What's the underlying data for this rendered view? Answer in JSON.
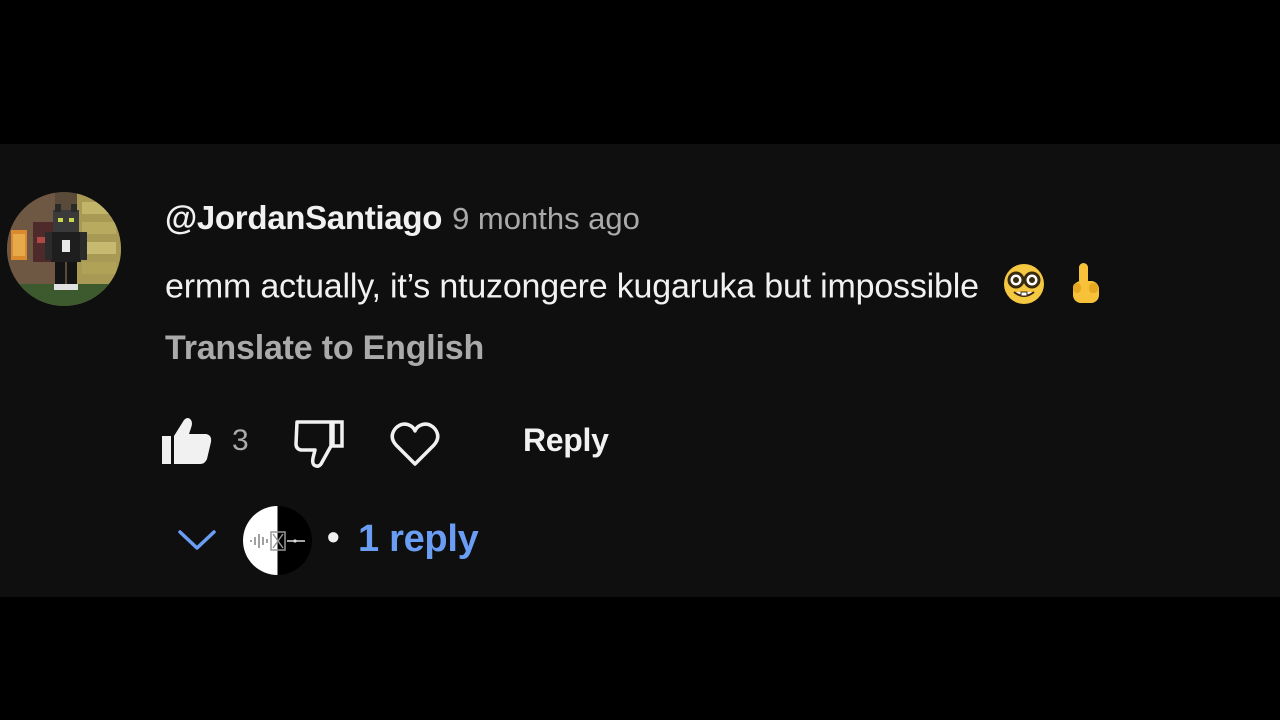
{
  "comment": {
    "author": "@JordanSantiago",
    "timestamp": "9 months ago",
    "text": "ermm actually, it’s ntuzongere kugaruka but impossible",
    "emojis": [
      "nerd-face-emoji",
      "index-pointing-up-emoji"
    ],
    "translate_label": "Translate to English",
    "like_count": "3",
    "reply_label": "Reply",
    "replies": {
      "separator": "•",
      "label": "1 reply"
    }
  },
  "colors": {
    "page_background": "#000000",
    "card_background": "#0f0f0f",
    "primary_text": "#f1f1f1",
    "secondary_text": "#aaaaaa",
    "replies_link": "#6a9ef5"
  },
  "icons": {
    "like": "thumbs-up-filled-icon",
    "dislike": "thumbs-down-outline-icon",
    "heart": "heart-outline-icon",
    "expand": "chevron-down-icon"
  }
}
